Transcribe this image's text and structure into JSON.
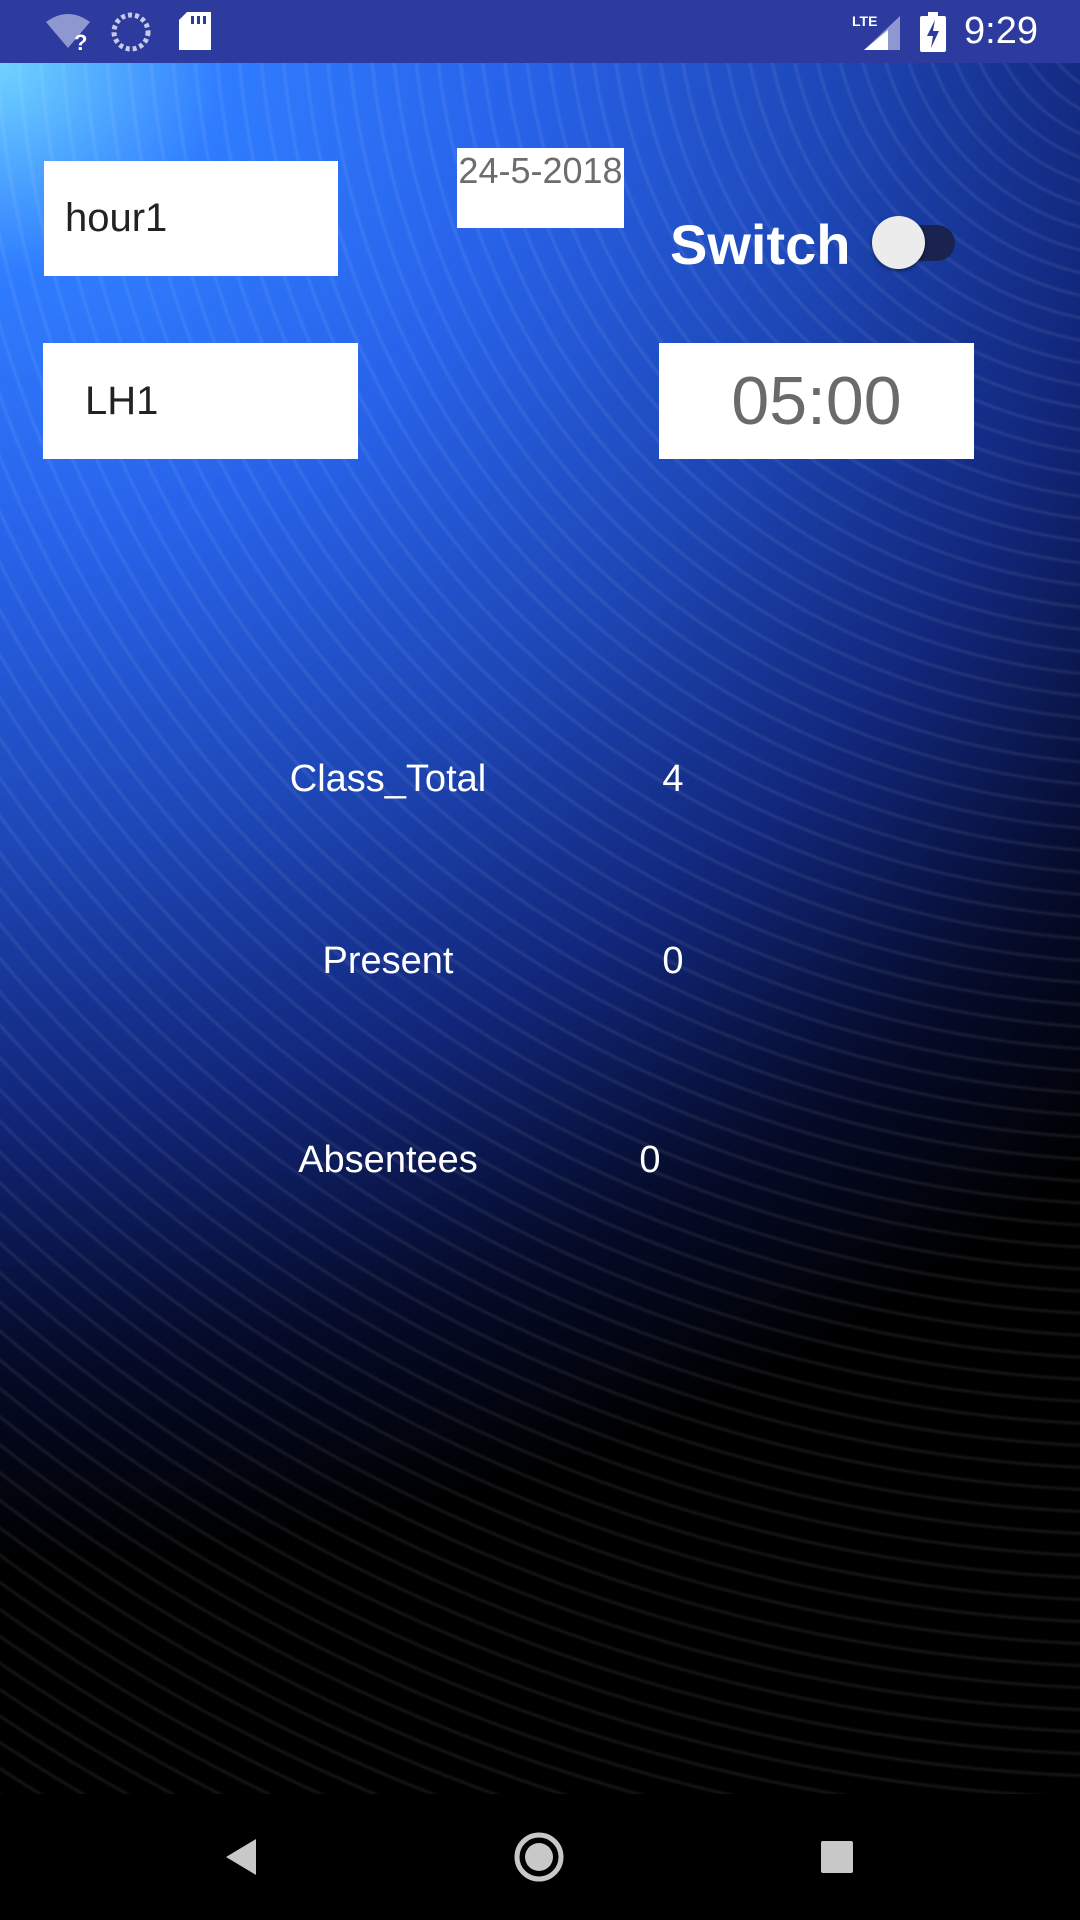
{
  "status_bar": {
    "time": "9:29",
    "network": "LTE",
    "icons": [
      "wifi-unknown-icon",
      "sync-icon",
      "sd-card-icon",
      "lte-signal-icon",
      "battery-charging-icon"
    ]
  },
  "form": {
    "hour_value": "hour1",
    "date_value": "24-5-2018",
    "room_value": "LH1",
    "timer_value": "05:00",
    "switch_label": "Switch",
    "switch_on": false
  },
  "stats": {
    "class_total_label": "Class_Total",
    "class_total_value": "4",
    "present_label": "Present",
    "present_value": "0",
    "absentees_label": "Absentees",
    "absentees_value": "0"
  },
  "nav_bar": {
    "icons": [
      "back-icon",
      "home-icon",
      "recents-icon"
    ]
  },
  "colors": {
    "status_bar": "#2d3a9e",
    "nav_bar": "#000000",
    "text_light": "#ffffff",
    "field_bg": "#ffffff"
  }
}
